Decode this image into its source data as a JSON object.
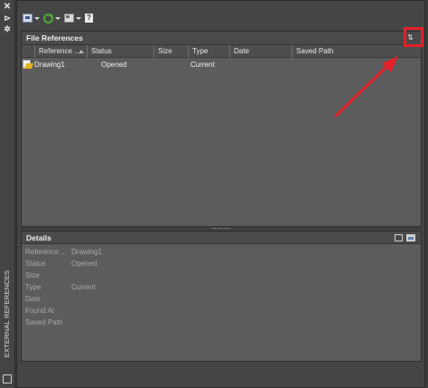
{
  "side_strip": {
    "close_glyph": "✕",
    "pin_glyph": "⊳",
    "settings_glyph": "✲",
    "label": "EXTERNAL REFERENCES"
  },
  "toolbar": {
    "buttons": [
      {
        "icon": "attach-dwg-icon",
        "has_dropdown": true
      },
      {
        "icon": "refresh-icon",
        "has_dropdown": true
      },
      {
        "icon": "change-path-icon",
        "has_dropdown": true
      },
      {
        "icon": "help-icon",
        "glyph": "?",
        "has_dropdown": false
      }
    ]
  },
  "file_references": {
    "title": "File References",
    "view_toggle_glyph": "⇅",
    "columns": [
      "Reference ...",
      "Status",
      "Size",
      "Type",
      "Date",
      "Saved Path"
    ],
    "sorted_column": "Reference ...",
    "rows": [
      {
        "name": "Drawing1",
        "status": "Opened",
        "size": "",
        "type": "Current",
        "date": "",
        "saved_path": "",
        "icon": "drawing-file-icon"
      }
    ]
  },
  "details": {
    "title": "Details",
    "fields": [
      {
        "key": "Reference ...",
        "value": "Drawing1"
      },
      {
        "key": "Status",
        "value": "Opened"
      },
      {
        "key": "Size",
        "value": ""
      },
      {
        "key": "Type",
        "value": "Current"
      },
      {
        "key": "Date",
        "value": ""
      },
      {
        "key": "Found At",
        "value": ""
      },
      {
        "key": "Saved Path",
        "value": ""
      }
    ]
  },
  "colors": {
    "panel_bg": "#5c5c5c",
    "header_bg": "#4a4a4a",
    "callout": "#e4202a"
  }
}
